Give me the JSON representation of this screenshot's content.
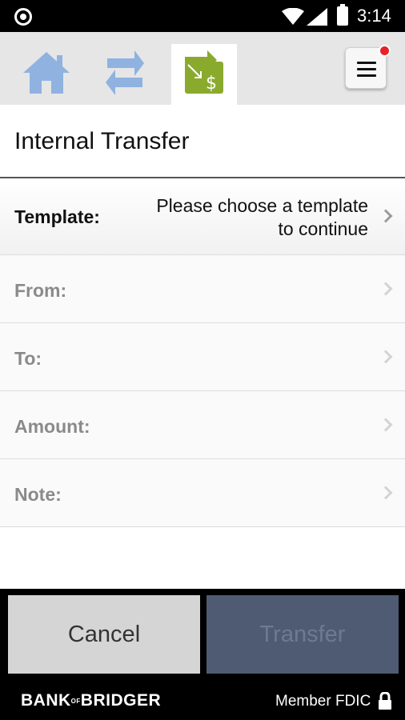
{
  "status_bar": {
    "time": "3:14"
  },
  "nav": {
    "items": [
      {
        "name": "home",
        "icon": "home-icon",
        "color": "#8fb2e0"
      },
      {
        "name": "transfers",
        "icon": "swap-arrows-icon",
        "color": "#8fb2e0"
      },
      {
        "name": "internal-transfer",
        "icon": "transfer-money-icon",
        "color": "#8aaa2e",
        "active": true
      }
    ],
    "menu_icon": "hamburger-icon",
    "notification_color": "#e8222b"
  },
  "page": {
    "title": "Internal Transfer"
  },
  "form": {
    "template": {
      "label": "Template:",
      "value_line1": "Please choose a template",
      "value_line2": "to continue"
    },
    "from": {
      "label": "From:"
    },
    "to": {
      "label": "To:"
    },
    "amount": {
      "label": "Amount:"
    },
    "note": {
      "label": "Note:"
    }
  },
  "actions": {
    "cancel_label": "Cancel",
    "transfer_label": "Transfer"
  },
  "footer": {
    "logo_part1": "BANK",
    "logo_of": "OF",
    "logo_part2": "BRIDGER",
    "fdic_label": "Member FDIC"
  }
}
